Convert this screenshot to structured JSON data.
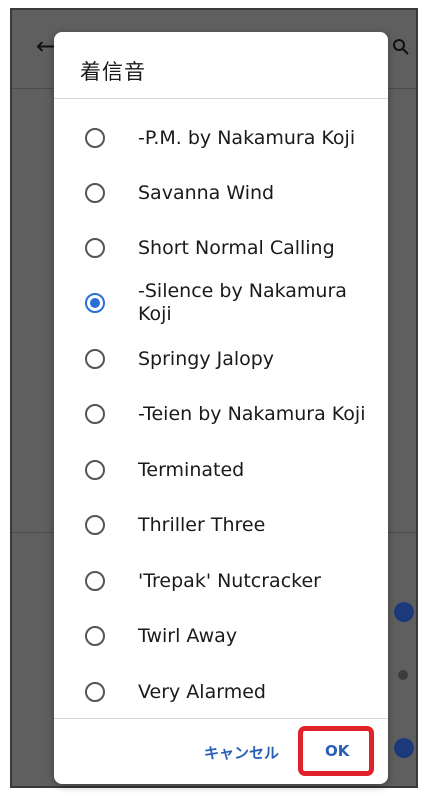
{
  "dialog": {
    "title": "着信音",
    "options": [
      {
        "label": "-P.M. by Nakamura Koji",
        "selected": false
      },
      {
        "label": "Savanna Wind",
        "selected": false
      },
      {
        "label": "Short Normal Calling",
        "selected": false
      },
      {
        "label": "-Silence by Nakamura Koji",
        "selected": true
      },
      {
        "label": "Springy Jalopy",
        "selected": false
      },
      {
        "label": "-Teien by Nakamura Koji",
        "selected": false
      },
      {
        "label": "Terminated",
        "selected": false
      },
      {
        "label": "Thriller Three",
        "selected": false
      },
      {
        "label": "'Trepak' Nutcracker",
        "selected": false
      },
      {
        "label": "Twirl Away",
        "selected": false
      },
      {
        "label": "Very Alarmed",
        "selected": false
      }
    ],
    "cancel_label": "キャンセル",
    "ok_label": "OK"
  },
  "background": {
    "back_icon": "arrow-left-icon",
    "search_icon": "search-icon"
  },
  "colors": {
    "accent": "#2a6fd6",
    "highlight": "#e2222b",
    "scrim": "#5f5f5f"
  }
}
